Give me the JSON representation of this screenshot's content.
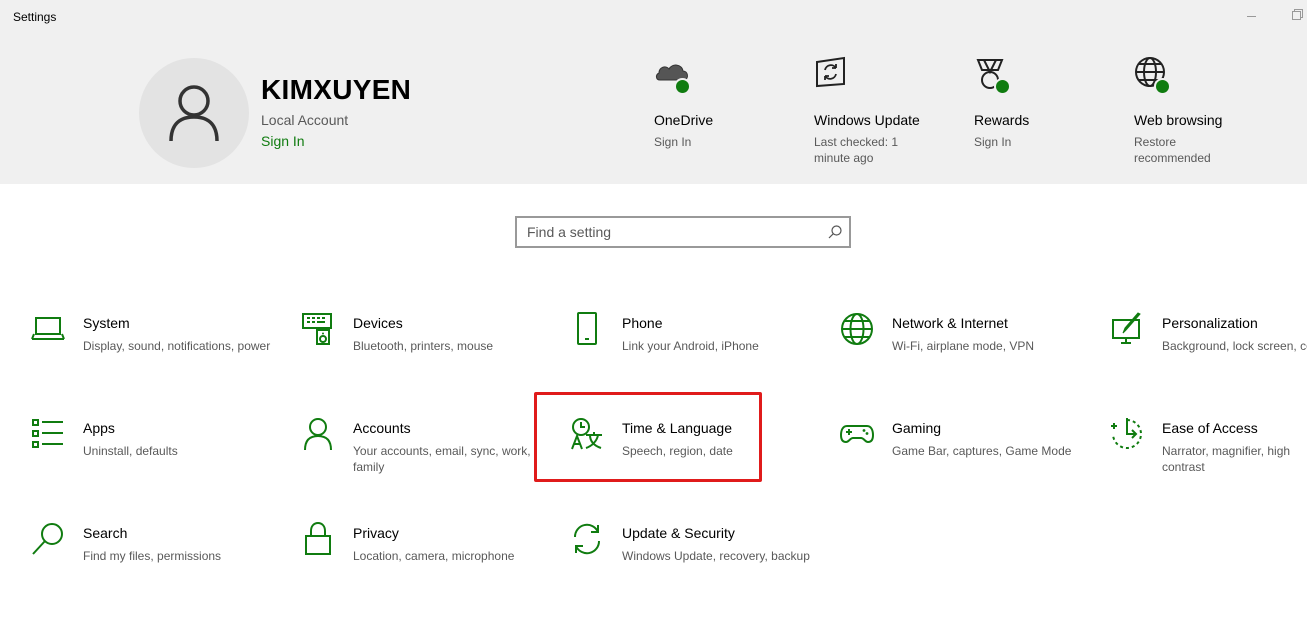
{
  "window": {
    "title": "Settings"
  },
  "user": {
    "name": "KIMXUYEN",
    "account_type": "Local Account",
    "sign_in": "Sign In"
  },
  "quick_links": [
    {
      "title": "OneDrive",
      "subtitle": "Sign In",
      "icon": "onedrive-cloud-icon"
    },
    {
      "title": "Windows Update",
      "subtitle": "Last checked: 1 minute ago",
      "icon": "windows-update-icon"
    },
    {
      "title": "Rewards",
      "subtitle": "Sign In",
      "icon": "rewards-medal-icon"
    },
    {
      "title": "Web browsing",
      "subtitle": "Restore recommended",
      "icon": "globe-icon"
    }
  ],
  "search": {
    "placeholder": "Find a setting"
  },
  "categories": [
    {
      "title": "System",
      "desc": "Display, sound, notifications, power",
      "icon": "laptop-icon"
    },
    {
      "title": "Devices",
      "desc": "Bluetooth, printers, mouse",
      "icon": "keyboard-speaker-icon"
    },
    {
      "title": "Phone",
      "desc": "Link your Android, iPhone",
      "icon": "phone-icon"
    },
    {
      "title": "Network & Internet",
      "desc": "Wi-Fi, airplane mode, VPN",
      "icon": "globe-icon"
    },
    {
      "title": "Personalization",
      "desc": "Background, lock screen, colors",
      "icon": "paintbrush-icon"
    },
    {
      "title": "Apps",
      "desc": "Uninstall, defaults",
      "icon": "apps-list-icon"
    },
    {
      "title": "Accounts",
      "desc": "Your accounts, email, sync, work, family",
      "icon": "person-icon"
    },
    {
      "title": "Time & Language",
      "desc": "Speech, region, date",
      "icon": "time-language-icon"
    },
    {
      "title": "Gaming",
      "desc": "Game Bar, captures, Game Mode",
      "icon": "gamepad-icon"
    },
    {
      "title": "Ease of Access",
      "desc": "Narrator, magnifier, high contrast",
      "icon": "ease-of-access-icon"
    },
    {
      "title": "Search",
      "desc": "Find my files, permissions",
      "icon": "magnifier-icon"
    },
    {
      "title": "Privacy",
      "desc": "Location, camera, microphone",
      "icon": "lock-icon"
    },
    {
      "title": "Update & Security",
      "desc": "Windows Update, recovery, backup",
      "icon": "sync-arrows-icon"
    }
  ],
  "colors": {
    "accent": "#107c10",
    "header_bg": "#f0f0f0",
    "highlight_box": "#e01b1b"
  }
}
